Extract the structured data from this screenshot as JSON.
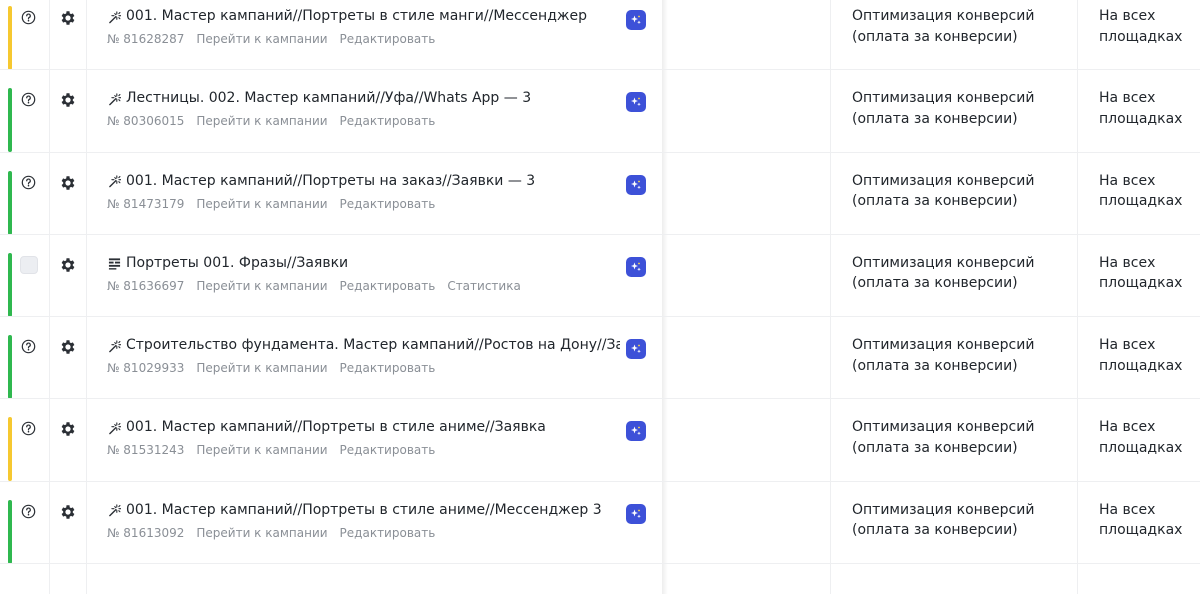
{
  "colors": {
    "status_yellow": "#f6c830",
    "status_green": "#2fb84f",
    "ai_badge": "#3d51d8"
  },
  "icons": {
    "help": "question-circle-icon",
    "settings": "gear-icon",
    "master_campaign": "magic-wand-icon",
    "text_campaign": "text-lines-icon",
    "ai": "sparkle-icon"
  },
  "rows": [
    {
      "status_color": "#f6c830",
      "control": "help",
      "type": "master",
      "name": "001. Мастер кампаний//Портреты в стиле манги//Мессенджер",
      "number": "№ 81628287",
      "links": [
        "Перейти к кампании",
        "Редактировать"
      ],
      "strategy_line1": "Оптимизация конверсий",
      "strategy_line2": "(оплата за конверсии)",
      "placement_line1": "На всех",
      "placement_line2": "площадках"
    },
    {
      "status_color": "#2fb84f",
      "control": "help",
      "type": "master",
      "name": "Лестницы. 002. Мастер кампаний//Уфа//Whats App — 3",
      "number": "№ 80306015",
      "links": [
        "Перейти к кампании",
        "Редактировать"
      ],
      "strategy_line1": "Оптимизация конверсий",
      "strategy_line2": "(оплата за конверсии)",
      "placement_line1": "На всех",
      "placement_line2": "площадках"
    },
    {
      "status_color": "#2fb84f",
      "control": "help",
      "type": "master",
      "name": "001. Мастер кампаний//Портреты на заказ//Заявки — 3",
      "number": "№ 81473179",
      "links": [
        "Перейти к кампании",
        "Редактировать"
      ],
      "strategy_line1": "Оптимизация конверсий",
      "strategy_line2": "(оплата за конверсии)",
      "placement_line1": "На всех",
      "placement_line2": "площадках"
    },
    {
      "status_color": "#2fb84f",
      "control": "checkbox",
      "type": "text",
      "name": "Портреты 001. Фразы//Заявки",
      "number": "№ 81636697",
      "links": [
        "Перейти к кампании",
        "Редактировать",
        "Статистика"
      ],
      "strategy_line1": "Оптимизация конверсий",
      "strategy_line2": "(оплата за конверсии)",
      "placement_line1": "На всех",
      "placement_line2": "площадках"
    },
    {
      "status_color": "#2fb84f",
      "control": "help",
      "type": "master",
      "name": "Строительство фундамента. Мастер кампаний//Ростов на Дону//Заявка -",
      "number": "№ 81029933",
      "links": [
        "Перейти к кампании",
        "Редактировать"
      ],
      "strategy_line1": "Оптимизация конверсий",
      "strategy_line2": "(оплата за конверсии)",
      "placement_line1": "На всех",
      "placement_line2": "площадках"
    },
    {
      "status_color": "#f6c830",
      "control": "help",
      "type": "master",
      "name": "001. Мастер кампаний//Портреты в стиле аниме//Заявка",
      "number": "№ 81531243",
      "links": [
        "Перейти к кампании",
        "Редактировать"
      ],
      "strategy_line1": "Оптимизация конверсий",
      "strategy_line2": "(оплата за конверсии)",
      "placement_line1": "На всех",
      "placement_line2": "площадках"
    },
    {
      "status_color": "#2fb84f",
      "control": "help",
      "type": "master",
      "name": "001. Мастер кампаний//Портреты в стиле аниме//Мессенджер 3",
      "number": "№ 81613092",
      "links": [
        "Перейти к кампании",
        "Редактировать"
      ],
      "strategy_line1": "Оптимизация конверсий",
      "strategy_line2": "(оплата за конверсии)",
      "placement_line1": "На всех",
      "placement_line2": "площадках"
    }
  ]
}
